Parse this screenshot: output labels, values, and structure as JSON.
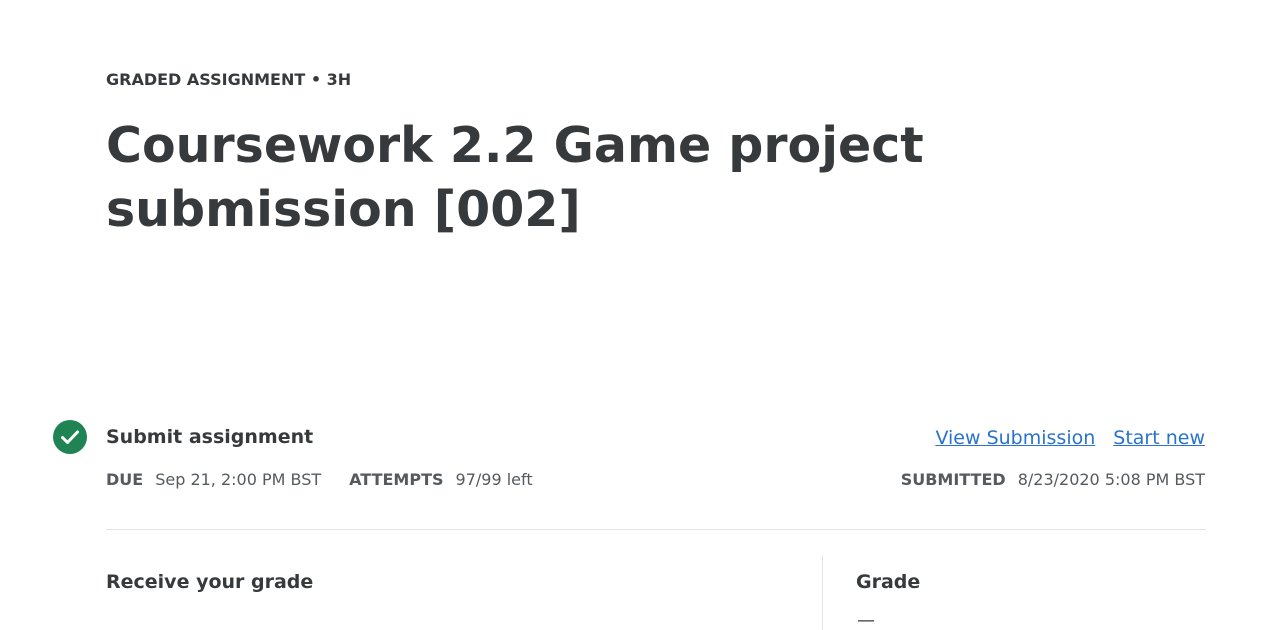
{
  "header": {
    "eyebrow": "GRADED ASSIGNMENT • 3H",
    "title": "Coursework 2.2 Game project submission [002]"
  },
  "submit_step": {
    "icon": "check-circle-icon",
    "status_color": "#1f8354",
    "title": "Submit assignment",
    "due_label": "DUE",
    "due_value": "Sep 21, 2:00 PM BST",
    "attempts_label": "ATTEMPTS",
    "attempts_value": "97/99 left",
    "view_submission_label": "View Submission",
    "start_new_label": "Start new",
    "submitted_label": "SUBMITTED",
    "submitted_value": "8/23/2020 5:08 PM BST",
    "link_color": "#2a73cc"
  },
  "grade_section": {
    "receive_title": "Receive your grade",
    "grade_title": "Grade",
    "grade_value": "—"
  }
}
